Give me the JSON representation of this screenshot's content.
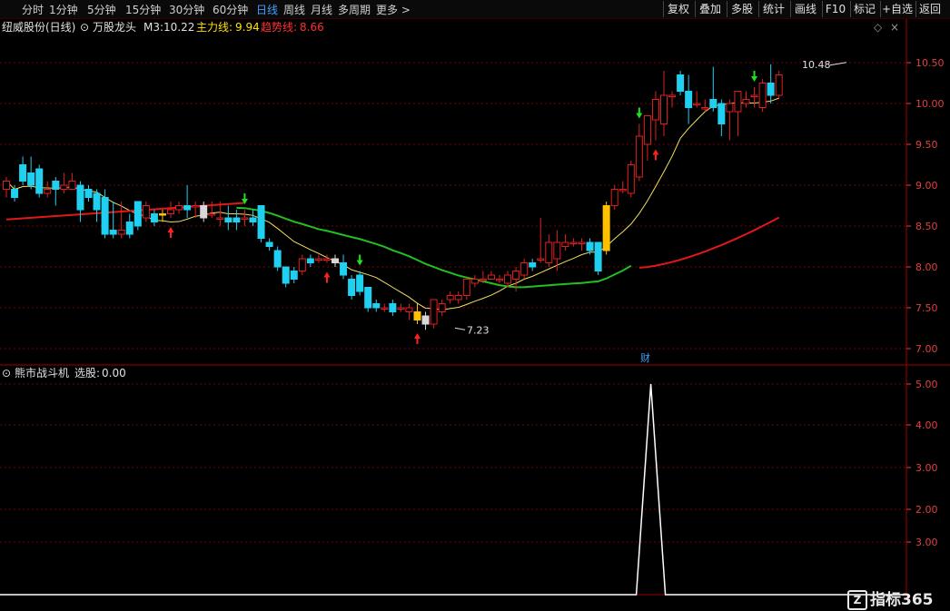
{
  "toolbar": {
    "periods": [
      {
        "label": "分时",
        "active": false
      },
      {
        "label": "1分钟",
        "active": false
      },
      {
        "label": "5分钟",
        "active": false
      },
      {
        "label": "15分钟",
        "active": false
      },
      {
        "label": "30分钟",
        "active": false
      },
      {
        "label": "60分钟",
        "active": false
      },
      {
        "label": "日线",
        "active": true
      },
      {
        "label": "周线",
        "active": false
      },
      {
        "label": "月线",
        "active": false
      },
      {
        "label": "多周期",
        "active": false
      },
      {
        "label": "更多",
        "active": false
      }
    ],
    "more_arrow": ">",
    "right_buttons": [
      "复权",
      "叠加",
      "多股",
      "统计",
      "画线",
      "F10",
      "标记",
      "+自选",
      "返回"
    ]
  },
  "main_panel": {
    "stock_title": "纽威股份(日线)",
    "indicator_name": "万股龙头",
    "m3_label": "M3:",
    "m3_value": "10.22",
    "main_line_label": "主力线:",
    "main_line_value": "9.94",
    "trend_line_label": "趋势线:",
    "trend_line_value": "8.66",
    "y_ticks": [
      "10.50",
      "10.00",
      "9.50",
      "9.00",
      "8.50",
      "8.00",
      "7.50",
      "7.00"
    ],
    "high_annotation": "10.48",
    "low_annotation": "7.23",
    "event_marker": "财"
  },
  "sub_panel": {
    "indicator_name": "熊市战斗机",
    "xuangu_label": "选股:",
    "xuangu_value": "0.00",
    "y_ticks": [
      "5.00",
      "4.00",
      "3.00",
      "2.00",
      "3.00"
    ]
  },
  "watermark": {
    "badge": "Z",
    "text": "指标365"
  },
  "colors": {
    "background": "#000000",
    "up_candle": "#e02020",
    "down_candle": "#20d0f0",
    "yellow_candle": "#ffc000",
    "white_candle": "#d8d8d8",
    "ma_yellow": "#f0e060",
    "ma_green": "#20c020",
    "ma_red": "#e01818",
    "grid": "#7a0000",
    "axis_text": "#e04040",
    "active_tab": "#40a0ff"
  },
  "chart_data": {
    "type": "candlestick",
    "y_range": [
      6.88,
      10.9
    ],
    "candles": [
      [
        8.95,
        9.05,
        8.85,
        9.1
      ],
      [
        8.95,
        8.85,
        8.8,
        9.0
      ],
      [
        9.25,
        9.05,
        9.0,
        9.35
      ],
      [
        9.15,
        9.0,
        8.95,
        9.35
      ],
      [
        9.2,
        8.9,
        8.85,
        9.25
      ],
      [
        8.9,
        8.95,
        8.85,
        9.05
      ],
      [
        9.05,
        8.95,
        8.75,
        9.1
      ],
      [
        8.95,
        9.0,
        8.9,
        9.15
      ],
      [
        8.95,
        9.05,
        8.95,
        9.15
      ],
      [
        9.0,
        8.7,
        8.55,
        9.05
      ],
      [
        8.95,
        8.85,
        8.8,
        9.0
      ],
      [
        8.9,
        8.7,
        8.55,
        8.95
      ],
      [
        8.85,
        8.4,
        8.35,
        8.95
      ],
      [
        8.45,
        8.4,
        8.35,
        8.8
      ],
      [
        8.4,
        8.45,
        8.35,
        8.8
      ],
      [
        8.55,
        8.4,
        8.35,
        8.65
      ],
      [
        8.8,
        8.5,
        8.45,
        8.8
      ],
      [
        8.6,
        8.75,
        8.55,
        8.8
      ],
      [
        8.65,
        8.55,
        8.5,
        8.7
      ],
      [
        8.65,
        8.65,
        8.55,
        8.7
      ],
      [
        8.65,
        8.7,
        8.6,
        8.8
      ],
      [
        8.7,
        8.75,
        8.65,
        8.8
      ],
      [
        8.75,
        8.7,
        8.6,
        9.0
      ],
      [
        8.75,
        8.75,
        8.6,
        8.8
      ],
      [
        8.75,
        8.6,
        8.55,
        8.8
      ],
      [
        8.65,
        8.65,
        8.6,
        8.8
      ],
      [
        8.6,
        8.6,
        8.5,
        8.8
      ],
      [
        8.6,
        8.55,
        8.45,
        8.75
      ],
      [
        8.6,
        8.55,
        8.45,
        8.7
      ],
      [
        8.6,
        8.6,
        8.5,
        8.7
      ],
      [
        8.6,
        8.55,
        8.5,
        8.7
      ],
      [
        8.75,
        8.35,
        8.3,
        8.75
      ],
      [
        8.3,
        8.25,
        8.2,
        8.35
      ],
      [
        8.2,
        8.0,
        7.95,
        8.25
      ],
      [
        8.0,
        7.8,
        7.75,
        8.0
      ],
      [
        7.95,
        7.85,
        7.8,
        8.0
      ],
      [
        7.95,
        8.1,
        7.9,
        8.15
      ],
      [
        8.1,
        8.05,
        8.0,
        8.15
      ],
      [
        8.1,
        8.1,
        8.05,
        8.15
      ],
      [
        8.1,
        8.1,
        8.05,
        8.15
      ],
      [
        8.05,
        8.1,
        8.0,
        8.15
      ],
      [
        8.05,
        7.9,
        7.85,
        8.15
      ],
      [
        7.85,
        7.65,
        7.6,
        7.9
      ],
      [
        7.9,
        7.7,
        7.65,
        7.95
      ],
      [
        7.75,
        7.5,
        7.45,
        7.75
      ],
      [
        7.55,
        7.5,
        7.45,
        7.6
      ],
      [
        7.5,
        7.5,
        7.45,
        7.55
      ],
      [
        7.55,
        7.45,
        7.4,
        7.6
      ],
      [
        7.5,
        7.5,
        7.45,
        7.55
      ],
      [
        7.45,
        7.5,
        7.35,
        7.55
      ],
      [
        7.45,
        7.35,
        7.3,
        7.55
      ],
      [
        7.4,
        7.3,
        7.23,
        7.45
      ],
      [
        7.3,
        7.6,
        7.25,
        7.6
      ],
      [
        7.45,
        7.55,
        7.4,
        7.6
      ],
      [
        7.6,
        7.65,
        7.55,
        7.7
      ],
      [
        7.6,
        7.65,
        7.55,
        7.7
      ],
      [
        7.65,
        7.85,
        7.6,
        7.85
      ],
      [
        7.8,
        7.85,
        7.75,
        7.9
      ],
      [
        7.85,
        7.85,
        7.8,
        7.95
      ],
      [
        7.85,
        7.9,
        7.85,
        7.95
      ],
      [
        7.85,
        7.85,
        7.8,
        7.9
      ],
      [
        7.8,
        7.9,
        7.75,
        7.95
      ],
      [
        7.85,
        7.95,
        7.7,
        8.0
      ],
      [
        7.9,
        8.05,
        7.85,
        8.1
      ],
      [
        8.05,
        8.0,
        7.95,
        8.1
      ],
      [
        8.1,
        8.1,
        8.05,
        8.6
      ],
      [
        8.05,
        8.3,
        8.0,
        8.4
      ],
      [
        8.1,
        8.3,
        7.95,
        8.45
      ],
      [
        8.25,
        8.3,
        8.2,
        8.4
      ],
      [
        8.3,
        8.3,
        8.25,
        8.35
      ],
      [
        8.3,
        8.3,
        8.2,
        8.35
      ],
      [
        8.3,
        8.2,
        8.15,
        8.35
      ],
      [
        8.3,
        7.95,
        7.9,
        8.3
      ],
      [
        8.2,
        8.75,
        8.15,
        8.8
      ],
      [
        8.75,
        8.95,
        8.7,
        9.0
      ],
      [
        8.95,
        8.95,
        8.9,
        9.05
      ],
      [
        8.9,
        9.25,
        8.85,
        9.3
      ],
      [
        9.1,
        9.6,
        9.05,
        9.75
      ],
      [
        9.5,
        9.85,
        9.3,
        9.85
      ],
      [
        9.8,
        10.05,
        9.55,
        10.15
      ],
      [
        9.75,
        10.1,
        9.6,
        10.4
      ],
      [
        10.1,
        10.1,
        9.95,
        10.15
      ],
      [
        10.35,
        10.15,
        10.1,
        10.4
      ],
      [
        10.15,
        9.95,
        9.75,
        10.35
      ],
      [
        10.0,
        10.0,
        9.95,
        10.15
      ],
      [
        9.95,
        9.95,
        9.9,
        10.05
      ],
      [
        10.05,
        9.95,
        9.9,
        10.45
      ],
      [
        10.0,
        9.75,
        9.6,
        10.05
      ],
      [
        9.9,
        10.0,
        9.55,
        10.05
      ],
      [
        9.9,
        10.15,
        9.6,
        10.15
      ],
      [
        10.0,
        10.05,
        9.95,
        10.15
      ],
      [
        10.1,
        10.1,
        9.95,
        10.2
      ],
      [
        9.95,
        10.25,
        9.9,
        10.3
      ],
      [
        10.25,
        10.1,
        10.0,
        10.48
      ],
      [
        10.1,
        10.35,
        10.05,
        10.4
      ]
    ],
    "sub_signal": {
      "baseline": 0,
      "peak": 5.0,
      "peak_index": 72
    }
  }
}
